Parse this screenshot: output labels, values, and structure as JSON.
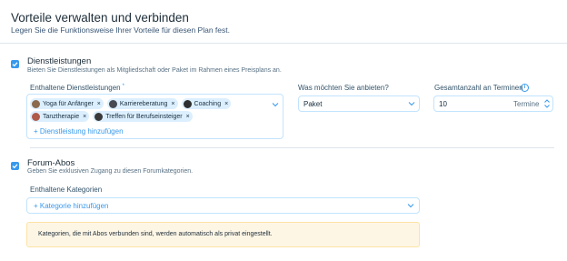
{
  "header": {
    "title": "Vorteile verwalten und verbinden",
    "subtitle": "Legen Sie die Funktionsweise Ihrer Vorteile für diesen Plan fest."
  },
  "services": {
    "checked": true,
    "title": "Dienstleistungen",
    "description": "Bieten Sie Dienstleistungen als Mitgliedschaft oder Paket im Rahmen eines Preisplans an.",
    "included_label": "Enthaltene Dienstleistungen",
    "required_mark": "*",
    "chips": [
      {
        "label": "Yoga für Anfänger",
        "remove": "×"
      },
      {
        "label": "Karriereberatung",
        "remove": "×"
      },
      {
        "label": "Coaching",
        "remove": "×"
      },
      {
        "label": "Tanztherapie",
        "remove": "×"
      },
      {
        "label": "Treffen für Berufseinsteiger",
        "remove": "×"
      }
    ],
    "add_link": "+ Dienstleistung hinzufügen",
    "offer_label": "Was möchten Sie anbieten?",
    "offer_value": "Paket",
    "total_label": "Gesamtanzahl an Terminen",
    "info_icon": "i",
    "total_value": "10",
    "total_unit": "Termine"
  },
  "forum": {
    "checked": true,
    "title": "Forum-Abos",
    "description": "Geben Sie exklusiven Zugang zu diesen Forumkategorien.",
    "categories_label": "Enthaltene Kategorien",
    "add_category": "+ Kategorie hinzufügen",
    "notice": "Kategorien, die mit Abos verbunden sind, werden automatisch als privat eingestellt."
  },
  "colors": {
    "accent": "#3899ec",
    "chip_bg": "#dcefff",
    "notice_bg": "#fef6e5"
  }
}
